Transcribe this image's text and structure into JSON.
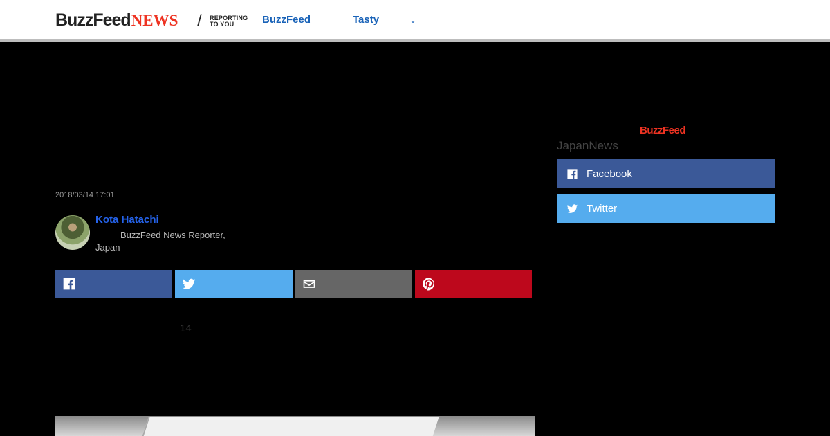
{
  "header": {
    "logo_buzz": "BuzzFeed",
    "logo_news": "NEWS",
    "slash": "/",
    "tagline_1": "REPORTING",
    "tagline_2": "TO YOU",
    "nav_buzzfeed": "BuzzFeed",
    "nav_tasty": "Tasty",
    "nav_more_icon": "chevron-down-icon"
  },
  "article": {
    "date": "2018/03/14 17:01",
    "author_name": "Kota Hatachi",
    "author_role": "BuzzFeed News Reporter, Japan",
    "share_buttons": [
      {
        "name": "facebook",
        "icon": "facebook-icon",
        "color": "#3b5998"
      },
      {
        "name": "twitter",
        "icon": "twitter-icon",
        "color": "#55acee"
      },
      {
        "name": "email",
        "icon": "mail-icon",
        "color": "#666666"
      },
      {
        "name": "pinterest",
        "icon": "pinterest-icon",
        "color": "#bd081c"
      }
    ],
    "count": "14"
  },
  "sidebar": {
    "logo": "BuzzFeed",
    "title": "JapanNews",
    "facebook_label": "Facebook",
    "twitter_label": "Twitter"
  },
  "colors": {
    "accent_blue": "#1a63b8",
    "brand_red": "#ee3322",
    "facebook": "#3b5998",
    "twitter": "#55acee",
    "pinterest": "#bd081c"
  }
}
